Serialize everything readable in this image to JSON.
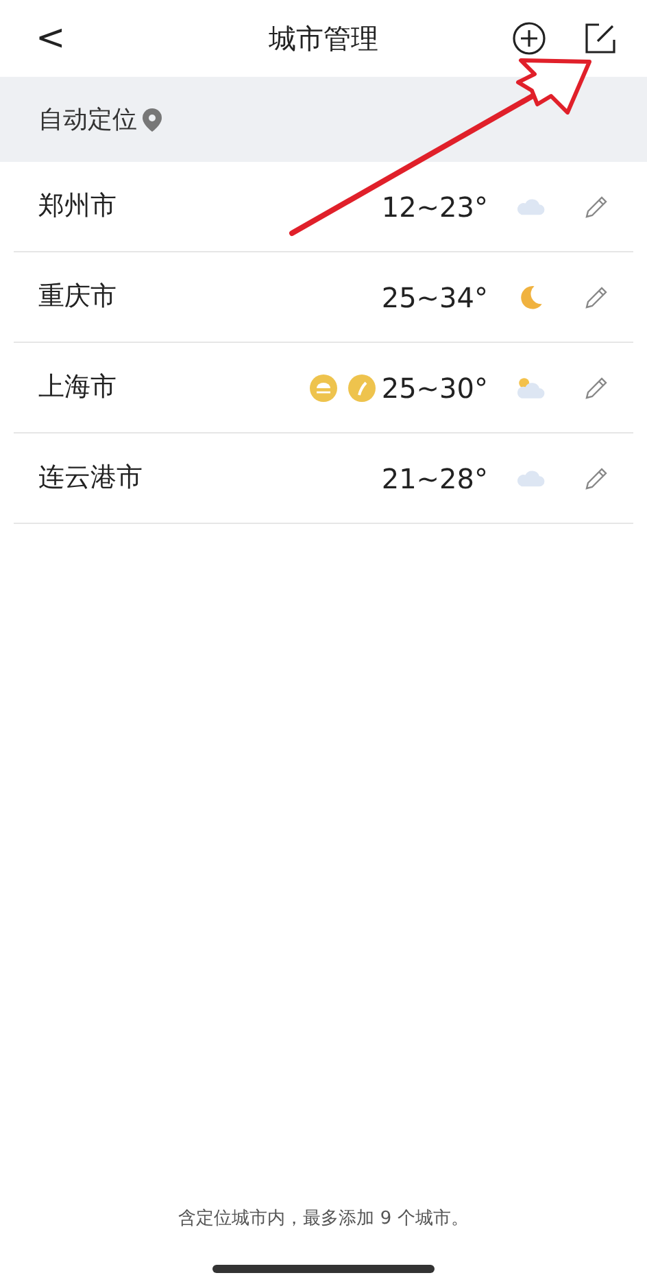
{
  "header": {
    "back": "<",
    "title": "城市管理"
  },
  "auto_location": {
    "label": "自动定位"
  },
  "cities": [
    {
      "name": "郑州市",
      "temp": "12~23°",
      "weather_icon": {
        "kind": "cloud"
      }
    },
    {
      "name": "重庆市",
      "temp": "25~34°",
      "weather_icon": {
        "kind": "moon"
      }
    },
    {
      "name": "上海市",
      "alerts": [
        {
          "kind": "rain"
        },
        {
          "kind": "wind"
        }
      ],
      "temp": "25~30°",
      "weather_icon": {
        "kind": "sun-cloud"
      }
    },
    {
      "name": "连云港市",
      "temp": "21~28°",
      "weather_icon": {
        "kind": "cloud"
      }
    }
  ],
  "footer": "含定位城市内，最多添加 9 个城市。",
  "annotation": {
    "kind": "arrow"
  }
}
